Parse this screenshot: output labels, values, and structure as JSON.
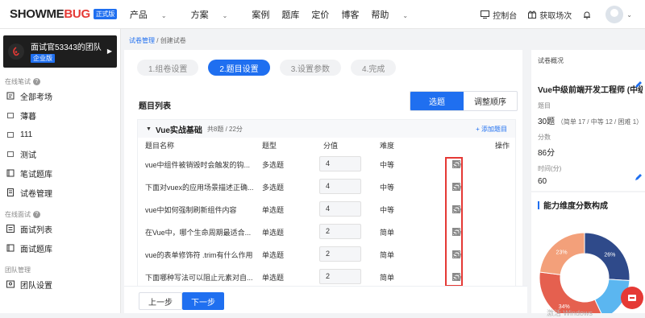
{
  "header": {
    "logo_text": "SHOWME",
    "logo_accent": "BUG",
    "logo_badge": "正式版",
    "nav": [
      "产品",
      "方案",
      "案例",
      "题库",
      "定价",
      "博客",
      "帮助"
    ],
    "console_label": "控制台",
    "get_sessions_label": "获取场次"
  },
  "sidebar": {
    "team_name": "面试官53343的团队",
    "team_plan": "企业版",
    "sections": [
      {
        "title": "在线笔试",
        "items": [
          {
            "label": "全部考场",
            "icon": "exam-icon"
          },
          {
            "label": "薄暮",
            "icon": "folder-icon"
          },
          {
            "label": "111",
            "icon": "folder-icon"
          },
          {
            "label": "测试",
            "icon": "folder-icon"
          },
          {
            "label": "笔试题库",
            "icon": "book-icon"
          },
          {
            "label": "试卷管理",
            "icon": "paper-icon"
          }
        ]
      },
      {
        "title": "在线面试",
        "items": [
          {
            "label": "面试列表",
            "icon": "list-icon"
          },
          {
            "label": "面试题库",
            "icon": "book-icon"
          }
        ]
      },
      {
        "title": "团队管理",
        "items": [
          {
            "label": "团队设置",
            "icon": "team-icon"
          }
        ]
      }
    ]
  },
  "breadcrumb": {
    "parent": "试卷管理",
    "sep": "/",
    "current": "创建试卷"
  },
  "steps": [
    "1.组卷设置",
    "2.题目设置",
    "3.设置参数",
    "4.完成"
  ],
  "active_step": 1,
  "list_title": "题目列表",
  "seg": {
    "left": "选题",
    "right": "调整顺序"
  },
  "group": {
    "name": "Vue实战基础",
    "meta": "共8题 / 22分",
    "add": "+ 添加题目",
    "columns": {
      "name": "题目名称",
      "type": "题型",
      "score": "分值",
      "difficulty": "难度",
      "ops": "操作"
    },
    "rows": [
      {
        "name": "vue中组件被销毁时会触发的钩...",
        "type": "多选题",
        "score": "4",
        "difficulty": "中等"
      },
      {
        "name": "下面对vuex的应用场景描述正确...",
        "type": "多选题",
        "score": "4",
        "difficulty": "中等"
      },
      {
        "name": "vue中如何强制刷新组件内容",
        "type": "单选题",
        "score": "4",
        "difficulty": "中等"
      },
      {
        "name": "在Vue中，哪个生命周期最适合...",
        "type": "单选题",
        "score": "2",
        "difficulty": "简单"
      },
      {
        "name": "vue的表单修饰符 .trim有什么作用",
        "type": "单选题",
        "score": "2",
        "difficulty": "简单"
      },
      {
        "name": "下面哪种写法可以阻止元素对自...",
        "type": "单选题",
        "score": "2",
        "difficulty": "简单"
      }
    ]
  },
  "footer": {
    "prev": "上一步",
    "next": "下一步"
  },
  "overview": {
    "title": "试卷概况",
    "role": "Vue中级前端开发工程师 (中级)",
    "q_label": "题目",
    "q_value": "30题",
    "q_detail": "（简单 17 / 中等 12 / 困难 1）",
    "score_label": "分数",
    "score_value": "86分",
    "time_label": "时间(分)",
    "time_value": "60"
  },
  "ability": {
    "title": "能力维度分数构成",
    "slices": [
      {
        "label": "26%",
        "value": 26,
        "color": "#2f4a8a"
      },
      {
        "label": "23%",
        "value": 23,
        "color": "#f3a07a"
      },
      {
        "label": "34%",
        "value": 34,
        "color": "#e5604f"
      },
      {
        "label": "",
        "value": 17,
        "color": "#5bb6f0"
      }
    ]
  },
  "watermark": "激活 Windows",
  "colors": {
    "primary": "#1f6ff0",
    "danger": "#e53935"
  }
}
